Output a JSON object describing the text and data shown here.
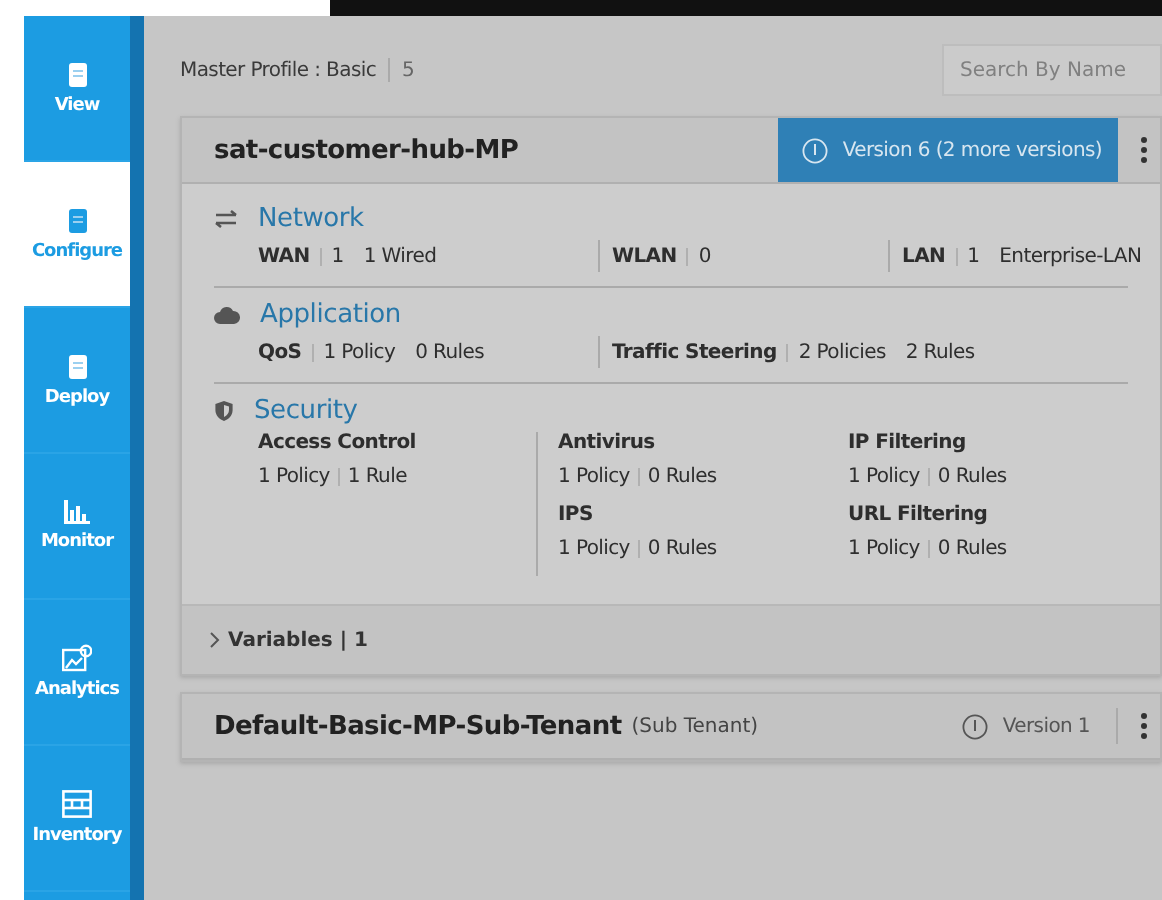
{
  "sidebar": {
    "items": [
      {
        "label": "View",
        "kind": "doc",
        "selected": false
      },
      {
        "label": "Configure",
        "kind": "doc",
        "selected": true
      },
      {
        "label": "Deploy",
        "kind": "doc",
        "selected": false
      },
      {
        "label": "Monitor",
        "kind": "bars",
        "selected": false
      },
      {
        "label": "Analytics",
        "kind": "image",
        "selected": false
      },
      {
        "label": "Inventory",
        "kind": "shelf",
        "selected": false
      }
    ]
  },
  "header": {
    "title": "Master Profile : Basic",
    "count": "5",
    "search": {
      "placeholder": "Search By Name"
    }
  },
  "profiles": [
    {
      "name": "sat-customer-hub-MP",
      "version": "Version 6 (2 more versions)",
      "highlighted": true,
      "sections": [
        {
          "title": "Network",
          "kind": "network",
          "items": [
            {
              "label": "WAN",
              "values": [
                "1",
                "1 Wired"
              ]
            },
            {
              "label": "WLAN",
              "values": [
                "0"
              ]
            },
            {
              "label": "LAN",
              "values": [
                "1",
                "Enterprise-LAN"
              ]
            }
          ]
        },
        {
          "title": "Application",
          "kind": "application",
          "items": [
            {
              "label": "QoS",
              "values": [
                "1 Policy",
                "0 Rules"
              ]
            },
            {
              "label": "Traffic Steering",
              "values": [
                "2 Policies",
                "2 Rules"
              ]
            }
          ]
        },
        {
          "title": "Security",
          "kind": "security",
          "items": [
            {
              "label": "Access Control",
              "values": [
                "1 Policy",
                "1 Rule"
              ]
            },
            {
              "label": "Antivirus",
              "values": [
                "1 Policy",
                "0 Rules"
              ]
            },
            {
              "label": "IP Filtering",
              "values": [
                "1 Policy",
                "0 Rules"
              ]
            },
            {
              "label": "IPS",
              "values": [
                "1 Policy",
                "0 Rules"
              ]
            },
            {
              "label": "URL Filtering",
              "values": [
                "1 Policy",
                "0 Rules"
              ]
            }
          ]
        }
      ],
      "variables": {
        "label": "Variables | 1",
        "expanded": false
      }
    },
    {
      "name": "Default-Basic-MP-Sub-Tenant",
      "subtitle": "(Sub Tenant)",
      "version": "Version 1",
      "highlighted": false
    }
  ]
}
